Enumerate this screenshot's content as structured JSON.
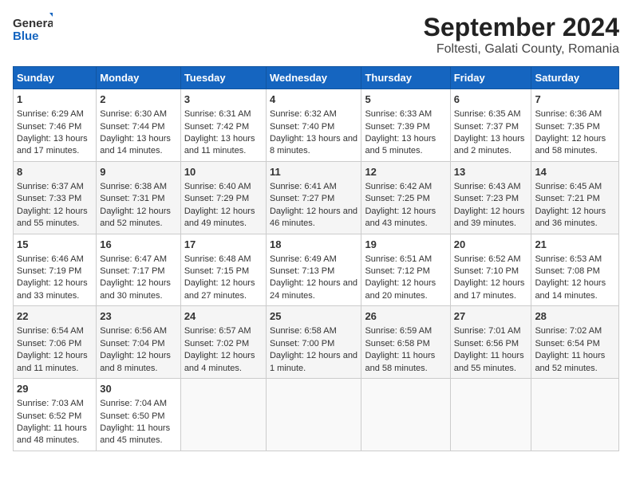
{
  "header": {
    "logo_general": "General",
    "logo_blue": "Blue",
    "title": "September 2024",
    "subtitle": "Foltesti, Galati County, Romania"
  },
  "calendar": {
    "days_of_week": [
      "Sunday",
      "Monday",
      "Tuesday",
      "Wednesday",
      "Thursday",
      "Friday",
      "Saturday"
    ],
    "weeks": [
      [
        {
          "day": "",
          "sunrise": "",
          "sunset": "",
          "daylight": ""
        },
        {
          "day": "2",
          "sunrise": "Sunrise: 6:30 AM",
          "sunset": "Sunset: 7:44 PM",
          "daylight": "Daylight: 13 hours and 14 minutes."
        },
        {
          "day": "3",
          "sunrise": "Sunrise: 6:31 AM",
          "sunset": "Sunset: 7:42 PM",
          "daylight": "Daylight: 13 hours and 11 minutes."
        },
        {
          "day": "4",
          "sunrise": "Sunrise: 6:32 AM",
          "sunset": "Sunset: 7:40 PM",
          "daylight": "Daylight: 13 hours and 8 minutes."
        },
        {
          "day": "5",
          "sunrise": "Sunrise: 6:33 AM",
          "sunset": "Sunset: 7:39 PM",
          "daylight": "Daylight: 13 hours and 5 minutes."
        },
        {
          "day": "6",
          "sunrise": "Sunrise: 6:35 AM",
          "sunset": "Sunset: 7:37 PM",
          "daylight": "Daylight: 13 hours and 2 minutes."
        },
        {
          "day": "7",
          "sunrise": "Sunrise: 6:36 AM",
          "sunset": "Sunset: 7:35 PM",
          "daylight": "Daylight: 12 hours and 58 minutes."
        }
      ],
      [
        {
          "day": "8",
          "sunrise": "Sunrise: 6:37 AM",
          "sunset": "Sunset: 7:33 PM",
          "daylight": "Daylight: 12 hours and 55 minutes."
        },
        {
          "day": "9",
          "sunrise": "Sunrise: 6:38 AM",
          "sunset": "Sunset: 7:31 PM",
          "daylight": "Daylight: 12 hours and 52 minutes."
        },
        {
          "day": "10",
          "sunrise": "Sunrise: 6:40 AM",
          "sunset": "Sunset: 7:29 PM",
          "daylight": "Daylight: 12 hours and 49 minutes."
        },
        {
          "day": "11",
          "sunrise": "Sunrise: 6:41 AM",
          "sunset": "Sunset: 7:27 PM",
          "daylight": "Daylight: 12 hours and 46 minutes."
        },
        {
          "day": "12",
          "sunrise": "Sunrise: 6:42 AM",
          "sunset": "Sunset: 7:25 PM",
          "daylight": "Daylight: 12 hours and 43 minutes."
        },
        {
          "day": "13",
          "sunrise": "Sunrise: 6:43 AM",
          "sunset": "Sunset: 7:23 PM",
          "daylight": "Daylight: 12 hours and 39 minutes."
        },
        {
          "day": "14",
          "sunrise": "Sunrise: 6:45 AM",
          "sunset": "Sunset: 7:21 PM",
          "daylight": "Daylight: 12 hours and 36 minutes."
        }
      ],
      [
        {
          "day": "15",
          "sunrise": "Sunrise: 6:46 AM",
          "sunset": "Sunset: 7:19 PM",
          "daylight": "Daylight: 12 hours and 33 minutes."
        },
        {
          "day": "16",
          "sunrise": "Sunrise: 6:47 AM",
          "sunset": "Sunset: 7:17 PM",
          "daylight": "Daylight: 12 hours and 30 minutes."
        },
        {
          "day": "17",
          "sunrise": "Sunrise: 6:48 AM",
          "sunset": "Sunset: 7:15 PM",
          "daylight": "Daylight: 12 hours and 27 minutes."
        },
        {
          "day": "18",
          "sunrise": "Sunrise: 6:49 AM",
          "sunset": "Sunset: 7:13 PM",
          "daylight": "Daylight: 12 hours and 24 minutes."
        },
        {
          "day": "19",
          "sunrise": "Sunrise: 6:51 AM",
          "sunset": "Sunset: 7:12 PM",
          "daylight": "Daylight: 12 hours and 20 minutes."
        },
        {
          "day": "20",
          "sunrise": "Sunrise: 6:52 AM",
          "sunset": "Sunset: 7:10 PM",
          "daylight": "Daylight: 12 hours and 17 minutes."
        },
        {
          "day": "21",
          "sunrise": "Sunrise: 6:53 AM",
          "sunset": "Sunset: 7:08 PM",
          "daylight": "Daylight: 12 hours and 14 minutes."
        }
      ],
      [
        {
          "day": "22",
          "sunrise": "Sunrise: 6:54 AM",
          "sunset": "Sunset: 7:06 PM",
          "daylight": "Daylight: 12 hours and 11 minutes."
        },
        {
          "day": "23",
          "sunrise": "Sunrise: 6:56 AM",
          "sunset": "Sunset: 7:04 PM",
          "daylight": "Daylight: 12 hours and 8 minutes."
        },
        {
          "day": "24",
          "sunrise": "Sunrise: 6:57 AM",
          "sunset": "Sunset: 7:02 PM",
          "daylight": "Daylight: 12 hours and 4 minutes."
        },
        {
          "day": "25",
          "sunrise": "Sunrise: 6:58 AM",
          "sunset": "Sunset: 7:00 PM",
          "daylight": "Daylight: 12 hours and 1 minute."
        },
        {
          "day": "26",
          "sunrise": "Sunrise: 6:59 AM",
          "sunset": "Sunset: 6:58 PM",
          "daylight": "Daylight: 11 hours and 58 minutes."
        },
        {
          "day": "27",
          "sunrise": "Sunrise: 7:01 AM",
          "sunset": "Sunset: 6:56 PM",
          "daylight": "Daylight: 11 hours and 55 minutes."
        },
        {
          "day": "28",
          "sunrise": "Sunrise: 7:02 AM",
          "sunset": "Sunset: 6:54 PM",
          "daylight": "Daylight: 11 hours and 52 minutes."
        }
      ],
      [
        {
          "day": "29",
          "sunrise": "Sunrise: 7:03 AM",
          "sunset": "Sunset: 6:52 PM",
          "daylight": "Daylight: 11 hours and 48 minutes."
        },
        {
          "day": "30",
          "sunrise": "Sunrise: 7:04 AM",
          "sunset": "Sunset: 6:50 PM",
          "daylight": "Daylight: 11 hours and 45 minutes."
        },
        {
          "day": "",
          "sunrise": "",
          "sunset": "",
          "daylight": ""
        },
        {
          "day": "",
          "sunrise": "",
          "sunset": "",
          "daylight": ""
        },
        {
          "day": "",
          "sunrise": "",
          "sunset": "",
          "daylight": ""
        },
        {
          "day": "",
          "sunrise": "",
          "sunset": "",
          "daylight": ""
        },
        {
          "day": "",
          "sunrise": "",
          "sunset": "",
          "daylight": ""
        }
      ]
    ],
    "first_row": [
      {
        "day": "1",
        "sunrise": "Sunrise: 6:29 AM",
        "sunset": "Sunset: 7:46 PM",
        "daylight": "Daylight: 13 hours and 17 minutes."
      }
    ]
  }
}
